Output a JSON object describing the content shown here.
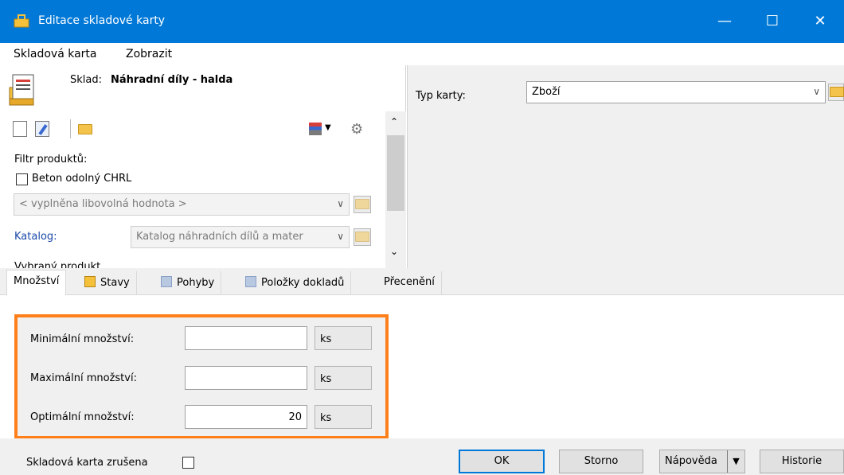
{
  "window": {
    "title": "Editace skladové karty",
    "app_icon": "warehouse-lock-icon"
  },
  "menu": [
    {
      "label": "Skladová karta"
    },
    {
      "label": "Zobrazit"
    }
  ],
  "left": {
    "sklad_label": "Sklad:",
    "sklad_value": "Náhradní díly - halda",
    "filter_label": "Filtr produktů:",
    "checkbox_label": "Beton odolný CHRL",
    "combo_placeholder": "< vyplněna libovolná hodnota >",
    "katalog_label": "Katalog:",
    "katalog_value": "Katalog náhradních dílů a mater",
    "cut_label": "Vybraný produkt"
  },
  "right": {
    "typ_label": "Typ karty:",
    "typ_value": "Zboží"
  },
  "tabs": [
    {
      "label": "Množství",
      "icon": ""
    },
    {
      "label": "Stavy",
      "icon": "forklift-icon"
    },
    {
      "label": "Pohyby",
      "icon": "documents-icon"
    },
    {
      "label": "Položky dokladů",
      "icon": "documents-icon"
    },
    {
      "label": "Přecenění",
      "icon": ""
    }
  ],
  "quantities": {
    "min_label": "Minimální množství:",
    "min_value": "",
    "max_label": "Maximální množství:",
    "max_value": "",
    "opt_label": "Optimální množství:",
    "opt_value": "20",
    "unit": "ks"
  },
  "bottom": {
    "cancelled_label": "Skladová karta zrušena",
    "ok": "OK",
    "storno": "Storno",
    "help": "Nápověda",
    "history": "Historie"
  },
  "colors": {
    "titlebar": "#0078d7",
    "highlight": "#ff7f1a"
  }
}
